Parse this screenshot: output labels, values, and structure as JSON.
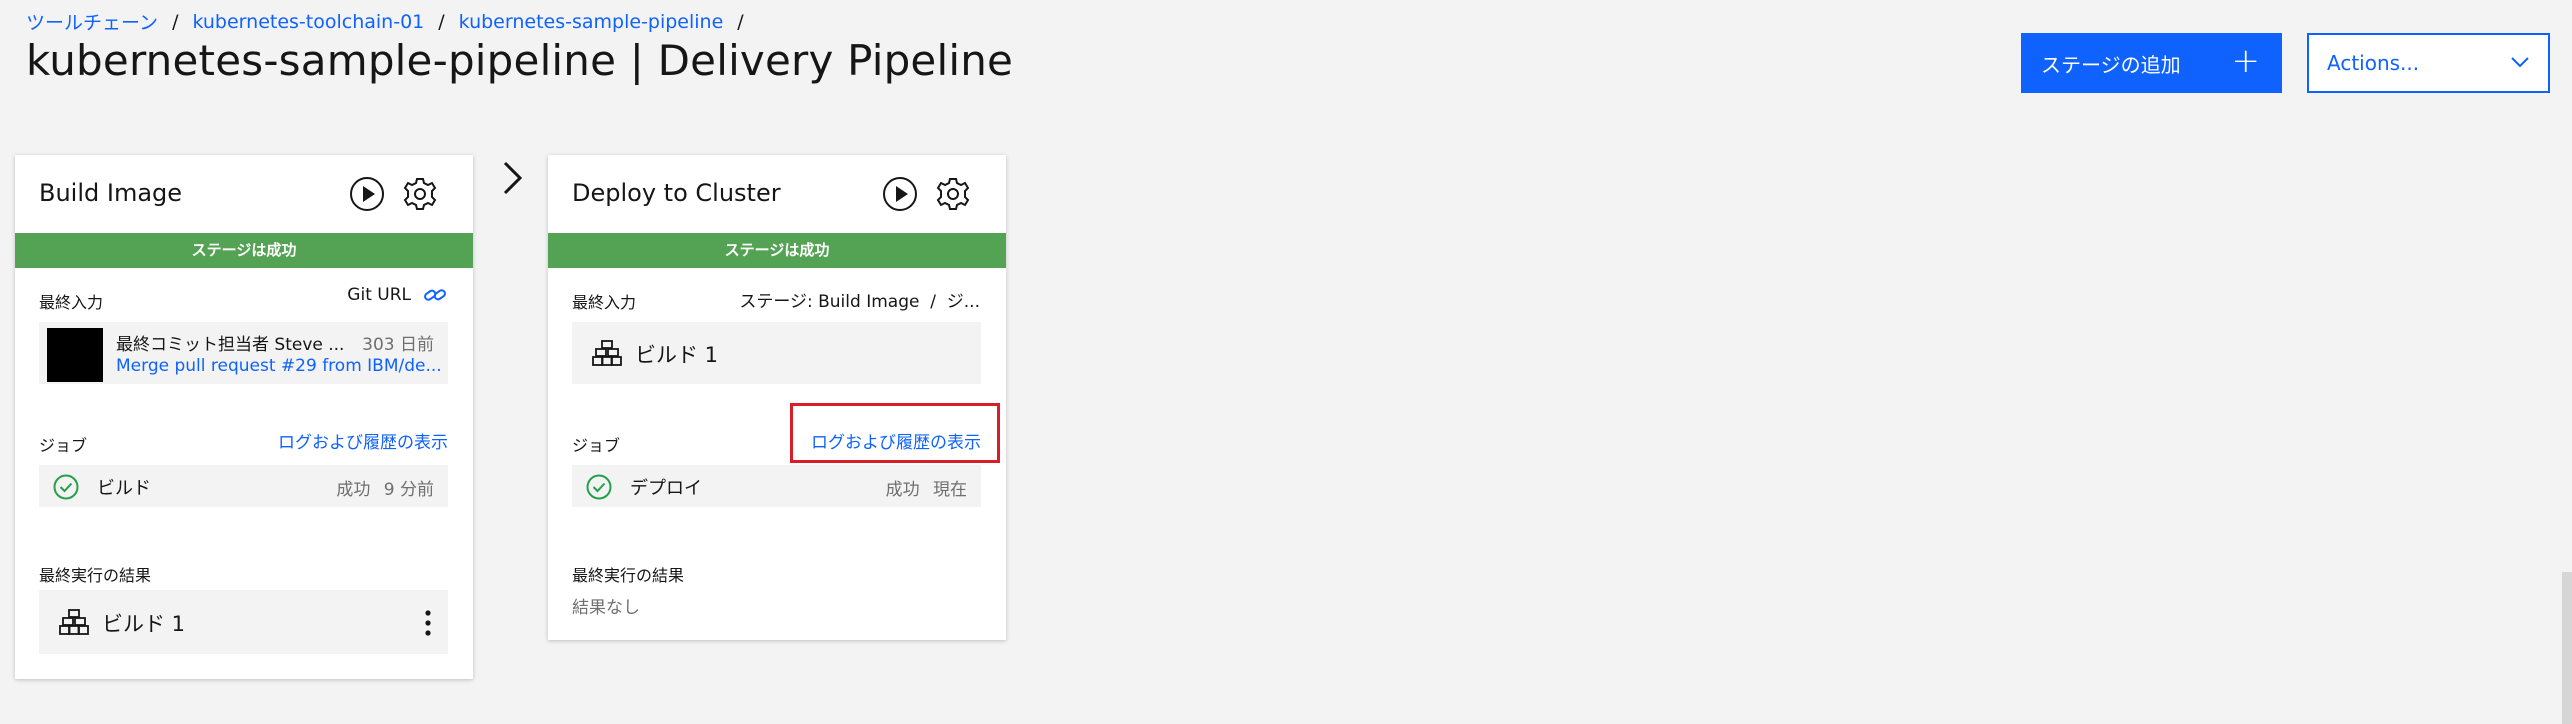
{
  "breadcrumb": [
    "ツールチェーン",
    "kubernetes-toolchain-01",
    "kubernetes-sample-pipeline"
  ],
  "breadcrumb_separator": "/",
  "page_title": "kubernetes-sample-pipeline | Delivery Pipeline",
  "header": {
    "add_stage_label": "ステージの追加",
    "actions_label": "Actions..."
  },
  "stages": [
    {
      "name": "Build Image",
      "status": "ステージは成功",
      "last_input_label": "最終入力",
      "input_source": "Git URL",
      "commit_author": "最終コミット担当者 Steve ...",
      "commit_age": "303 日前",
      "commit_message": "Merge pull request #29 from IBM/de...",
      "jobs_label": "ジョブ",
      "logs_link": "ログおよび履歴の表示",
      "job": {
        "name": "ビルド",
        "result": "成功",
        "time": "9 分前"
      },
      "last_result_label": "最終実行の結果",
      "last_result": "ビルド 1"
    },
    {
      "name": "Deploy to Cluster",
      "status": "ステージは成功",
      "last_input_label": "最終入力",
      "input_source": "ステージ: Build Image  /  ジ...",
      "input_build": "ビルド 1",
      "jobs_label": "ジョブ",
      "logs_link": "ログおよび履歴の表示",
      "job": {
        "name": "デプロイ",
        "result": "成功",
        "time": "現在"
      },
      "last_result_label": "最終実行の結果",
      "last_result": "結果なし"
    }
  ],
  "colors": {
    "accent": "#0f62fe",
    "success": "#54a354",
    "highlight": "#da1e28",
    "background": "#f3f3f3"
  }
}
